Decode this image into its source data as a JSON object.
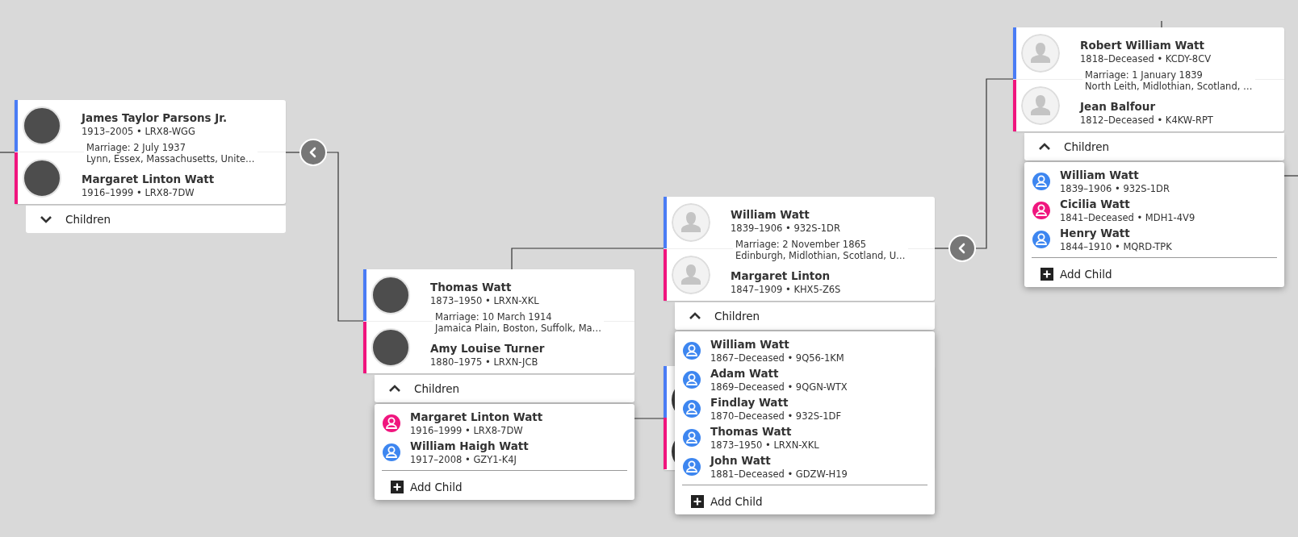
{
  "couples": [
    {
      "spouses": [
        {
          "name": "James Taylor Parsons Jr.",
          "dates": "1913–2005 • LRX8-WGG",
          "color": "#4a7cf5",
          "photo": true
        },
        {
          "name": "Margaret Linton Watt",
          "dates": "1916–1999 • LRX8-7DW",
          "color": "#f0157e",
          "photo": true
        }
      ],
      "marriage": {
        "date": "Marriage: 2 July 1937",
        "place": "Lynn, Essex, Massachusetts, Unite…"
      },
      "children_toggle": {
        "label": "Children",
        "expanded": false
      }
    },
    {
      "spouses": [
        {
          "name": "Thomas Watt",
          "dates": "1873–1950 • LRXN-XKL",
          "color": "#4a7cf5",
          "photo": true
        },
        {
          "name": "Amy Louise Turner",
          "dates": "1880–1975 • LRXN-JCB",
          "color": "#f0157e",
          "photo": true
        }
      ],
      "marriage": {
        "date": "Marriage: 10 March 1914",
        "place": "Jamaica Plain, Boston, Suffolk, Ma…"
      },
      "children_toggle": {
        "label": "Children",
        "expanded": true
      },
      "children": [
        {
          "name": "Margaret Linton Watt",
          "dates": "1916–1999 • LRX8-7DW",
          "color": "#f0157e"
        },
        {
          "name": "William Haigh Watt",
          "dates": "1917–2008 • GZY1-K4J",
          "color": "#3d86f0"
        }
      ],
      "add_child": "Add Child"
    },
    {
      "spouses": [
        {
          "name": "William Watt",
          "dates": "1839–1906 • 932S-1DR",
          "color": "#4a7cf5",
          "photo": false
        },
        {
          "name": "Margaret Linton",
          "dates": "1847–1909 • KHX5-Z6S",
          "color": "#f0157e",
          "photo": false
        }
      ],
      "marriage": {
        "date": "Marriage: 2 November 1865",
        "place": "Edinburgh, Midlothian, Scotland, U…"
      },
      "children_toggle": {
        "label": "Children",
        "expanded": true
      },
      "children": [
        {
          "name": "William Watt",
          "dates": "1867–Deceased • 9Q56-1KM",
          "color": "#3d86f0"
        },
        {
          "name": "Adam Watt",
          "dates": "1869–Deceased • 9QGN-WTX",
          "color": "#3d86f0"
        },
        {
          "name": "Findlay Watt",
          "dates": "1870–Deceased • 932S-1DF",
          "color": "#3d86f0"
        },
        {
          "name": "Thomas Watt",
          "dates": "1873–1950 • LRXN-XKL",
          "color": "#3d86f0"
        },
        {
          "name": "John Watt",
          "dates": "1881–Deceased • GDZW-H19",
          "color": "#3d86f0"
        }
      ],
      "add_child": "Add Child"
    },
    {
      "spouses": [
        {
          "name": "Robert William Watt",
          "dates": "1818–Deceased • KCDY-8CV",
          "color": "#4a7cf5",
          "photo": false
        },
        {
          "name": "Jean Balfour",
          "dates": "1812–Deceased • K4KW-RPT",
          "color": "#f0157e",
          "photo": false
        }
      ],
      "marriage": {
        "date": "Marriage: 1 January 1839",
        "place": "North Leith, Midlothian, Scotland, …"
      },
      "children_toggle": {
        "label": "Children",
        "expanded": true
      },
      "children": [
        {
          "name": "William Watt",
          "dates": "1839–1906 • 932S-1DR",
          "color": "#3d86f0"
        },
        {
          "name": "Cicilia Watt",
          "dates": "1841–Deceased • MDH1-4V9",
          "color": "#f0157e"
        },
        {
          "name": "Henry Watt",
          "dates": "1844–1910 • MQRD-TPK",
          "color": "#3d86f0"
        }
      ],
      "add_child": "Add Child"
    }
  ]
}
